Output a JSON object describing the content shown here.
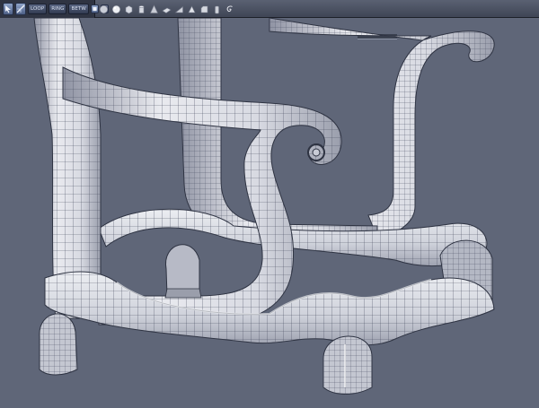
{
  "toolbar": {
    "select_tools": [
      {
        "icon": "select-arrow-icon"
      },
      {
        "icon": "select-edge-icon"
      }
    ],
    "buttons": {
      "loop": "LOOP",
      "ring": "RING",
      "betw": "BETW"
    },
    "toggles": [
      {
        "icon": "mode-toggle-icon"
      },
      {
        "icon": "settings-icon"
      }
    ],
    "shape_tools": [
      {
        "icon": "sphere-icon"
      },
      {
        "icon": "sphere-icon"
      },
      {
        "icon": "box-icon"
      },
      {
        "icon": "cylinder-icon"
      },
      {
        "icon": "cone-icon"
      },
      {
        "icon": "plane-icon"
      },
      {
        "icon": "wedge-icon"
      },
      {
        "icon": "prism-icon"
      },
      {
        "icon": "bevel-icon"
      },
      {
        "icon": "cylinder-icon"
      },
      {
        "icon": "spiral-icon"
      }
    ]
  },
  "viewport": {
    "background": "#5f6678",
    "model": "wireframe-chair-base"
  }
}
